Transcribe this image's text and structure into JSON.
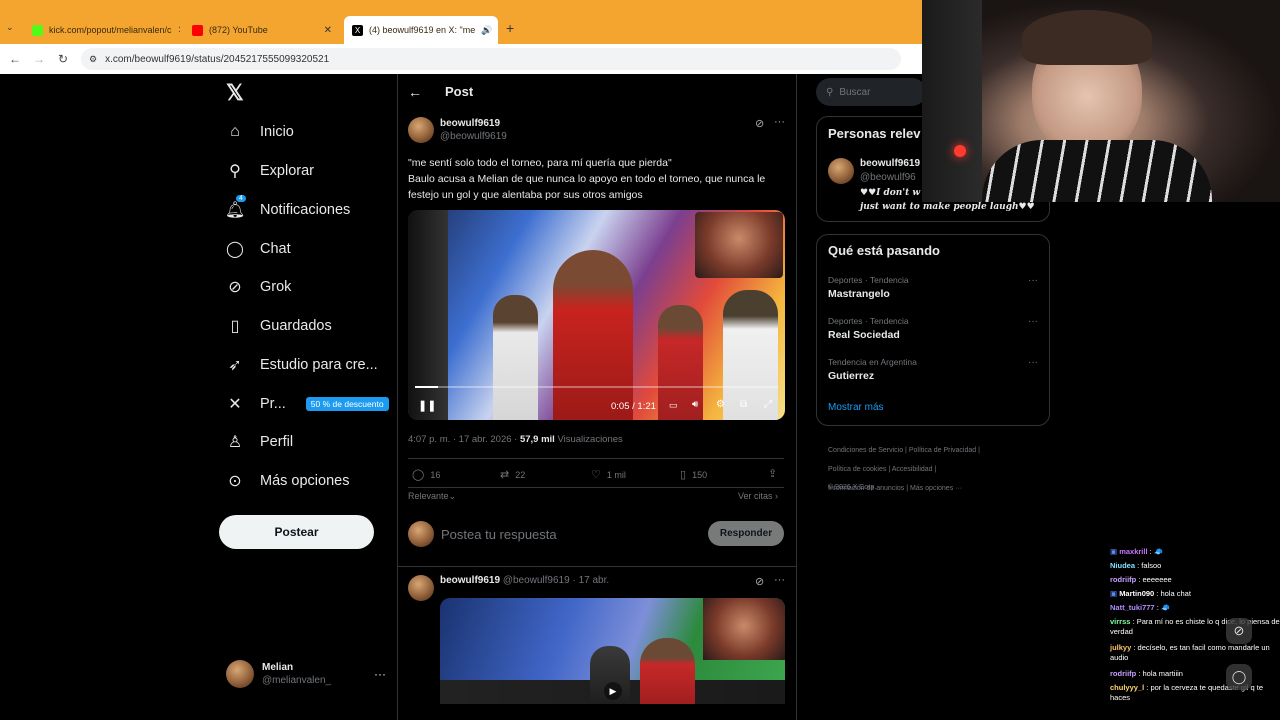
{
  "browser": {
    "tabs": [
      {
        "label": "kick.com/popout/melianvalen/c",
        "active": false
      },
      {
        "label": "(872) YouTube",
        "active": false
      },
      {
        "label": "(4) beowulf9619 en X: \"me",
        "active": true
      }
    ],
    "url": "x.com/beowulf9619/status/2045217555099320521"
  },
  "nav": {
    "items": [
      {
        "label": "Inicio",
        "icon": "home-icon"
      },
      {
        "label": "Explorar",
        "icon": "search-icon"
      },
      {
        "label": "Notificaciones",
        "icon": "bell-icon",
        "badge": "4"
      },
      {
        "label": "Chat",
        "icon": "chat-icon"
      },
      {
        "label": "Grok",
        "icon": "grok-icon"
      },
      {
        "label": "Guardados",
        "icon": "bookmark-icon"
      },
      {
        "label": "Estudio para cre...",
        "icon": "rocket-icon"
      },
      {
        "label": "Pr...",
        "icon": "x-logo-icon",
        "badge_text": "50 % de descuento"
      },
      {
        "label": "Perfil",
        "icon": "person-icon"
      },
      {
        "label": "Más opciones",
        "icon": "more-circle-icon"
      }
    ],
    "post_button": "Postear",
    "account": {
      "name": "Melian",
      "handle": "@melianvalen_"
    }
  },
  "post": {
    "header": "Post",
    "author": {
      "name": "beowulf9619",
      "handle": "@beowulf9619"
    },
    "text_line1": "\"me sentí solo todo el torneo, para mí quería que pierda\"",
    "text_line2": "Baulo acusa a Melian de que nunca lo apoyo en todo el torneo, que nunca le festejo un gol y que alentaba por sus otros amigos",
    "video_time": "0:05 / 1:21",
    "progress": 0.062,
    "meta_time": "4:07 p. m. · 17 abr. 2026 · ",
    "views_count": "57,9 mil",
    "views_label": "Visualizaciones",
    "stats": {
      "replies": "16",
      "reposts": "22",
      "likes": "1 mil",
      "bookmarks": "150"
    },
    "sort_label": "Relevante",
    "quotes_label": "Ver citas",
    "reply_placeholder": "Postea tu respuesta",
    "reply_button": "Responder"
  },
  "reply_post": {
    "name": "beowulf9619",
    "handle_date": "@beowulf9619 · 17 abr."
  },
  "right": {
    "search_placeholder": "Buscar",
    "people_title": "Personas relev",
    "person": {
      "name": "beowulf9619",
      "handle": "@beowulf96",
      "bio_line1": "I don't w",
      "bio_line2": "just want to make people laugh"
    },
    "trends_title": "Qué está pasando",
    "trends": [
      {
        "category": "Deportes · Tendencia",
        "name": "Mastrangelo"
      },
      {
        "category": "Deportes · Tendencia",
        "name": "Real Sociedad"
      },
      {
        "category": "Tendencia en Argentina",
        "name": "Gutierrez"
      }
    ],
    "show_more": "Mostrar más",
    "footer": [
      "Condiciones de Servicio",
      "Política de Privacidad",
      "Política de cookies",
      "Accesibilidad",
      "Información de anuncios",
      "Más opciones ···",
      "© 2026 X Corp."
    ]
  },
  "chat": [
    {
      "user": "maxkrill",
      "msg": "",
      "color": "#c874ff"
    },
    {
      "user": "Niudea",
      "msg": "falsoo",
      "color": "#7fe3ff"
    },
    {
      "user": "rodriifp",
      "msg": "eeeeeee",
      "color": "#c8a0ff"
    },
    {
      "user": "Martin090",
      "msg": "hola chat",
      "color": "#ffffff"
    },
    {
      "user": "Natt_tuki777",
      "msg": "",
      "color": "#b38cff"
    },
    {
      "user": "virrss",
      "msg": "Para mí no es chiste lo q dice, lo piensa de verdad",
      "color": "#7cff9e"
    },
    {
      "user": "julkyy",
      "msg": "decíselo, es tan facil como mandarle un audio",
      "color": "#ffc26b"
    },
    {
      "user": "rodriifp",
      "msg": "hola martiiin",
      "color": "#c8a0ff"
    },
    {
      "user": "chulyyy_l",
      "msg": "por la cerveza te quedaste gil q te haces",
      "color": "#ffd76b"
    }
  ]
}
